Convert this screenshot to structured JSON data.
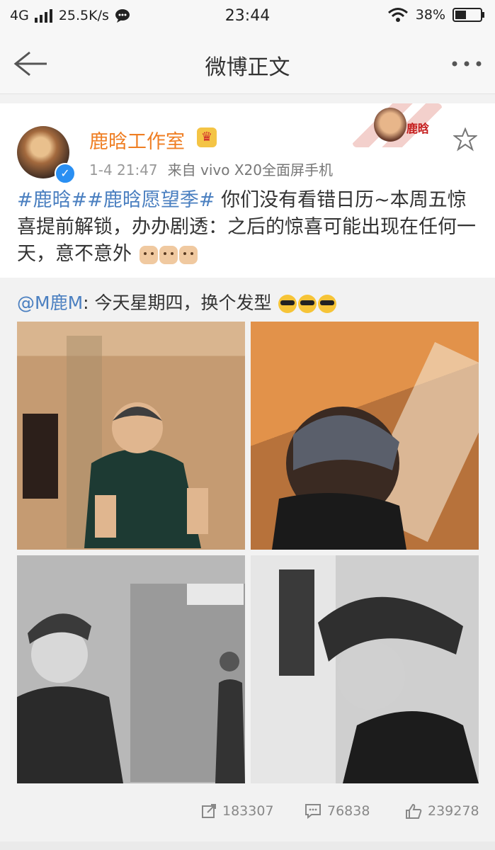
{
  "status_bar": {
    "network": "4G",
    "speed": "25.5K/s",
    "time": "23:44",
    "battery": "38%"
  },
  "nav": {
    "title": "微博正文"
  },
  "post": {
    "username": "鹿晗工作室",
    "timestamp": "1-4 21:47",
    "source": "来自 vivo X20全面屏手机",
    "text_hashtags": "#鹿晗##鹿晗愿望季#",
    "text_body": "你们没有看错日历~本周五惊喜提前解锁，办办剧透：之后的惊喜可能出现在任何一天，意不意外",
    "sticker_text": "鹿晗"
  },
  "repost": {
    "mention": "@M鹿M",
    "text": ": 今天星期四，换个发型"
  },
  "actions": {
    "reposts": "183307",
    "comments": "76838",
    "likes": "239278"
  },
  "icons": [
    "back-arrow-icon",
    "more-icon",
    "signal-icon",
    "chat-icon",
    "wifi-icon",
    "battery-icon",
    "verified-icon",
    "crown-icon",
    "star-icon",
    "repost-icon",
    "comment-icon",
    "like-icon"
  ]
}
